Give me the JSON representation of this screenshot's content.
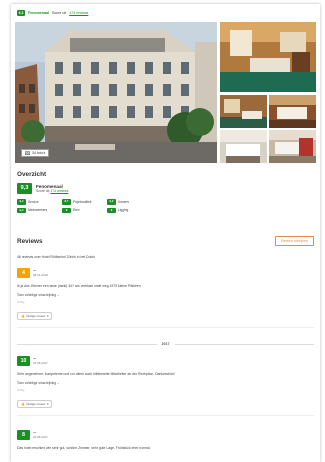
{
  "top": {
    "score": "9,3",
    "label": "Fenomenaal",
    "score_text": "Score uit",
    "reviews_link": "174 reviews"
  },
  "gallery": {
    "photos_button": "34 foto's"
  },
  "overview": {
    "title": "Overzicht",
    "score": "9,3",
    "label": "Fenomenaal",
    "score_text": "Score uit",
    "reviews_link": "174 reviews",
    "categories": [
      {
        "score": "9,4",
        "label": "Service"
      },
      {
        "score": "8,7",
        "label": "Prijs/kwaliteit"
      },
      {
        "score": "9,2",
        "label": "Kamers"
      },
      {
        "score": "9,4",
        "label": "Medewerkers"
      },
      {
        "score": "9",
        "label": "Eten"
      },
      {
        "score": "9",
        "label": "Ligging"
      }
    ]
  },
  "reviews": {
    "title": "Reviews",
    "write_button": "Review schrijven",
    "count_line": "46 reviews over Hotel Rütlisehof Zürich in het Dutch",
    "year_separator": "2017",
    "items": [
      {
        "score": "4",
        "name": "—",
        "date": "08-01-2018",
        "text": "Ik ja dus Zimmer een laste (dank) 34? ww verblaar unde weg 1979 kleine Pilkkeen",
        "more": "Toon volledige omschrijving",
        "small": "Nuttig",
        "useful": "Nuttige review",
        "useful_count": "0"
      },
      {
        "score": "10",
        "name": "—",
        "date": "20-08-2017",
        "text": "Sehr angenehme, kompetente und vor allem auch hilfsbereite Mitarbeiter an der Rezeption. Dankeschön!",
        "more": "Toon volledige omschrijving",
        "small": "Nuttig",
        "useful": "Nuttige review",
        "useful_count": "0"
      },
      {
        "score": "8",
        "name": "—",
        "date": "20-08-2017",
        "text": "Das hotel erschien wie sehr gut, schöne Zimmer, sehr gute Lage, Frühstück eher normal."
      }
    ]
  },
  "colors": {
    "score_green": "#1a8f24",
    "accent_orange": "#e38a4b"
  }
}
